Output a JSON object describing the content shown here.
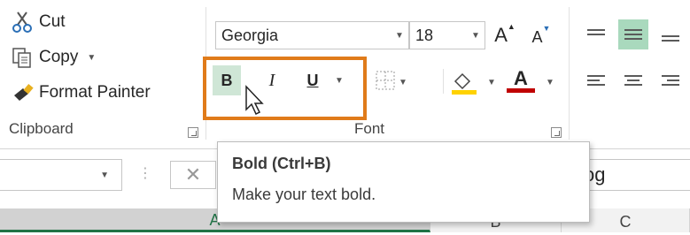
{
  "clipboard": {
    "cut_label": "Cut",
    "copy_label": "Copy",
    "format_painter_label": "Format Painter",
    "group_label": "Clipboard"
  },
  "font": {
    "font_name": "Georgia",
    "font_size": "18",
    "bold_label": "B",
    "italic_label": "I",
    "underline_label": "U",
    "font_color_label": "A",
    "grow_label": "A",
    "shrink_label": "A",
    "group_label": "Font"
  },
  "tooltip": {
    "title": "Bold (Ctrl+B)",
    "description": "Make your text bold."
  },
  "formula_bar": {
    "content": "og"
  },
  "columns": {
    "a": "A",
    "b": "B",
    "c": "C"
  },
  "colors": {
    "highlight_border": "#e07b1a",
    "bold_button_active": "#cfe6d6",
    "align_active": "#a9d9bd",
    "font_color_underline": "#c00000",
    "fill_color_underline": "#ffd200"
  }
}
